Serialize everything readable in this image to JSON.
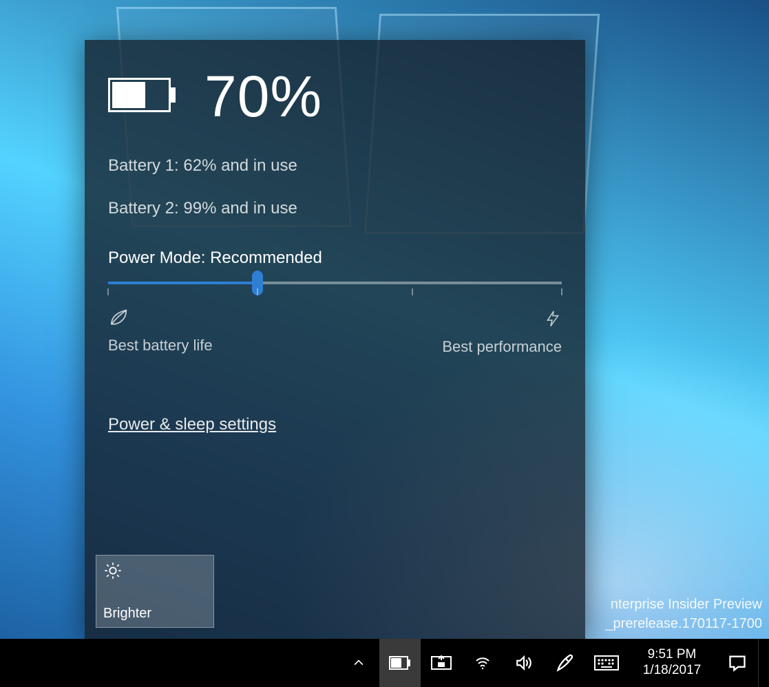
{
  "flyout": {
    "percentage": "70%",
    "battery1": "Battery 1: 62% and in use",
    "battery2": "Battery 2: 99% and in use",
    "power_mode_label": "Power Mode: Recommended",
    "slider": {
      "value_pct": 33,
      "ticks": [
        0,
        33,
        67,
        100
      ]
    },
    "left_end": "Best battery life",
    "right_end": "Best performance",
    "settings_link": "Power & sleep settings",
    "brightness_tile": "Brighter"
  },
  "watermark": {
    "line1": "nterprise Insider Preview",
    "line2": "_prerelease.170117-1700"
  },
  "taskbar": {
    "time": "9:51 PM",
    "date": "1/18/2017"
  }
}
